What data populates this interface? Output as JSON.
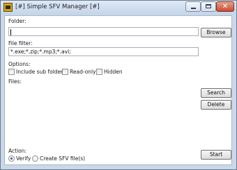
{
  "window": {
    "title": "[#] Simple SFV Manager [#]",
    "close_glyph": "✕",
    "icon": "app-icon"
  },
  "folder": {
    "label": "Folder:",
    "value": "",
    "browse_label": "Browse"
  },
  "file_filter": {
    "label": "File filter:",
    "value": "*.exe;*.zip;*.mp3;*.avi;"
  },
  "options": {
    "label": "Options:",
    "include_subfolders": {
      "label": "Include sub folders",
      "checked": false
    },
    "read_only": {
      "label": "Read-only",
      "checked": false
    },
    "hidden": {
      "label": "Hidden",
      "checked": false
    }
  },
  "files": {
    "label": "Files:",
    "search_label": "Search",
    "delete_label": "Delete"
  },
  "action": {
    "label": "Action:",
    "verify": {
      "label": "Verify",
      "checked": true
    },
    "create_sfv": {
      "label": "Create SFV file(s)",
      "checked": false
    },
    "start_label": "Start"
  }
}
